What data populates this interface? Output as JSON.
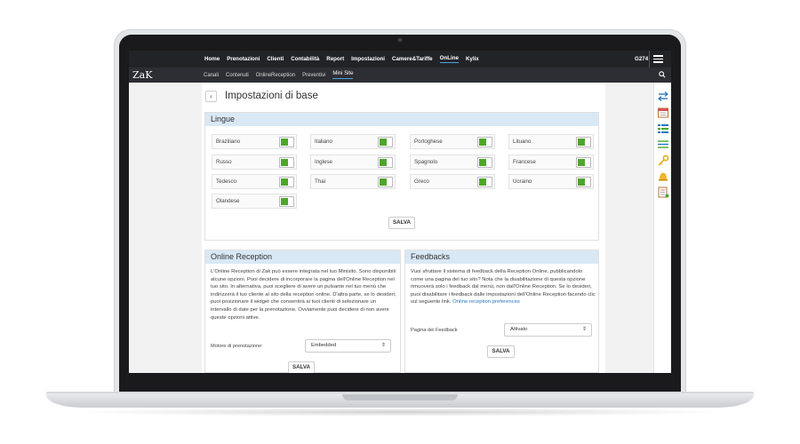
{
  "app": {
    "logo": "ZaK",
    "user": "G274"
  },
  "nav": {
    "items": [
      "Home",
      "Prenotazioni",
      "Clienti",
      "Contabilità",
      "Report",
      "Impostazioni",
      "Camere&Tariffe",
      "OnLine",
      "Kylix"
    ],
    "active": "OnLine"
  },
  "subnav": {
    "items": [
      "Canali",
      "Contenuti",
      "OnlineReception",
      "Preventivi",
      "Mini Site"
    ],
    "active": "Mini Site"
  },
  "page": {
    "title": "Impostazioni di base",
    "back_icon": "‹"
  },
  "lingue": {
    "title": "Lingue",
    "languages": [
      "Braziliano",
      "Italiano",
      "Portoghese",
      "Lituano",
      "Russo",
      "Inglese",
      "Spagnolo",
      "Francese",
      "Tedesco",
      "Thai",
      "Greco",
      "Ucraino",
      "Olandese"
    ],
    "save_label": "SALVA"
  },
  "online_reception": {
    "title": "Online Reception",
    "body": "L'Online Reception di Zak può essere integrata nel tuo Minisito. Sono disponibili alcune opzioni. Puoi decidere di incorporare la pagina dell'Online Reception nel tuo sito. In alternativa, puoi scegliere di avere un pulsante nel tuo menù che indirizzerà il tuo cliente al sito della reception online. D'altra parte, se lo desideri, puoi posizionare il widget che consentirà ai tuoi clienti di selezionare un intervallo di date per la prenotazione. Ovviamente puoi decidere di non avere queste opzioni attive.",
    "field_label": "Motore di prenotazione:",
    "field_value": "Embedded",
    "save_label": "SALVA"
  },
  "feedbacks": {
    "title": "Feedbacks",
    "body": "Vuoi sfruttare il sistema di feedback della Reception Online, pubblicandolo come una pagina del tuo sito? Nota che la disabilitazione di questa opzione rimuoverà solo i feedback dal menù, non dall'Online Reception. Se lo desideri, puoi disabilitare i feedback dalle impostazioni dell'Online Reception facendo clic sul seguente link.",
    "link_text": "Online reception preferences",
    "field_label": "Pagina dei Feedback",
    "field_value": "Attivato",
    "save_label": "SALVA"
  },
  "colors": {
    "toggle_on": "#4fa52c",
    "panel_head": "#d9e8f5",
    "topbar": "#222327",
    "accent": "#4aa3df"
  },
  "right_icons": [
    "swap-arrows-icon",
    "calendar-icon",
    "list-icon",
    "lines-icon",
    "key-icon",
    "bell-icon",
    "sheet-icon"
  ]
}
